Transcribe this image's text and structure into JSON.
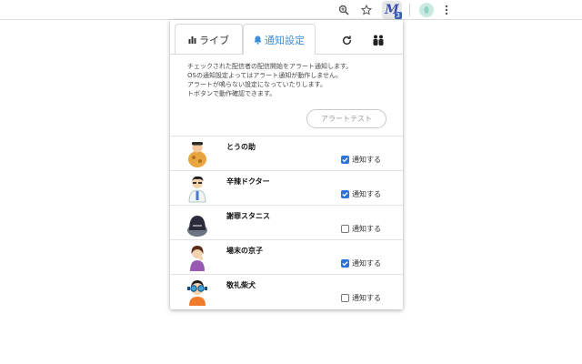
{
  "toolbar": {
    "zoom_icon": "zoom-icon",
    "star_icon": "star-icon",
    "extension": {
      "letter": "M",
      "badge": "3"
    },
    "profile_icon": "profile-icon",
    "menu_icon": "menu-icon"
  },
  "popup": {
    "tabs": {
      "live_label": "ライブ",
      "notify_label": "通知設定",
      "refresh_icon": "refresh-icon",
      "people_icon": "people-icon"
    },
    "description": [
      "チェックされた配信者の配信開始をアラート通知します。",
      "OSの通知設定よってはアラート通知が動作しません。",
      "アラートが鳴らない設定になっていたりします。",
      "トボタンで動作確認できます。"
    ],
    "alert_test_label": "アラートテスト",
    "items": [
      {
        "name": "とうの助",
        "notify_label": "通知する",
        "checked": true
      },
      {
        "name": "辛辣ドクター",
        "notify_label": "通知する",
        "checked": true
      },
      {
        "name": "謝罪スタニス",
        "notify_label": "通知する",
        "checked": false
      },
      {
        "name": "場末の京子",
        "notify_label": "通知する",
        "checked": true
      },
      {
        "name": "敬礼柴犬",
        "notify_label": "通知する",
        "checked": false
      }
    ]
  },
  "colors": {
    "accent": "#3d8ed8",
    "checkbox_on": "#2f73d6"
  }
}
